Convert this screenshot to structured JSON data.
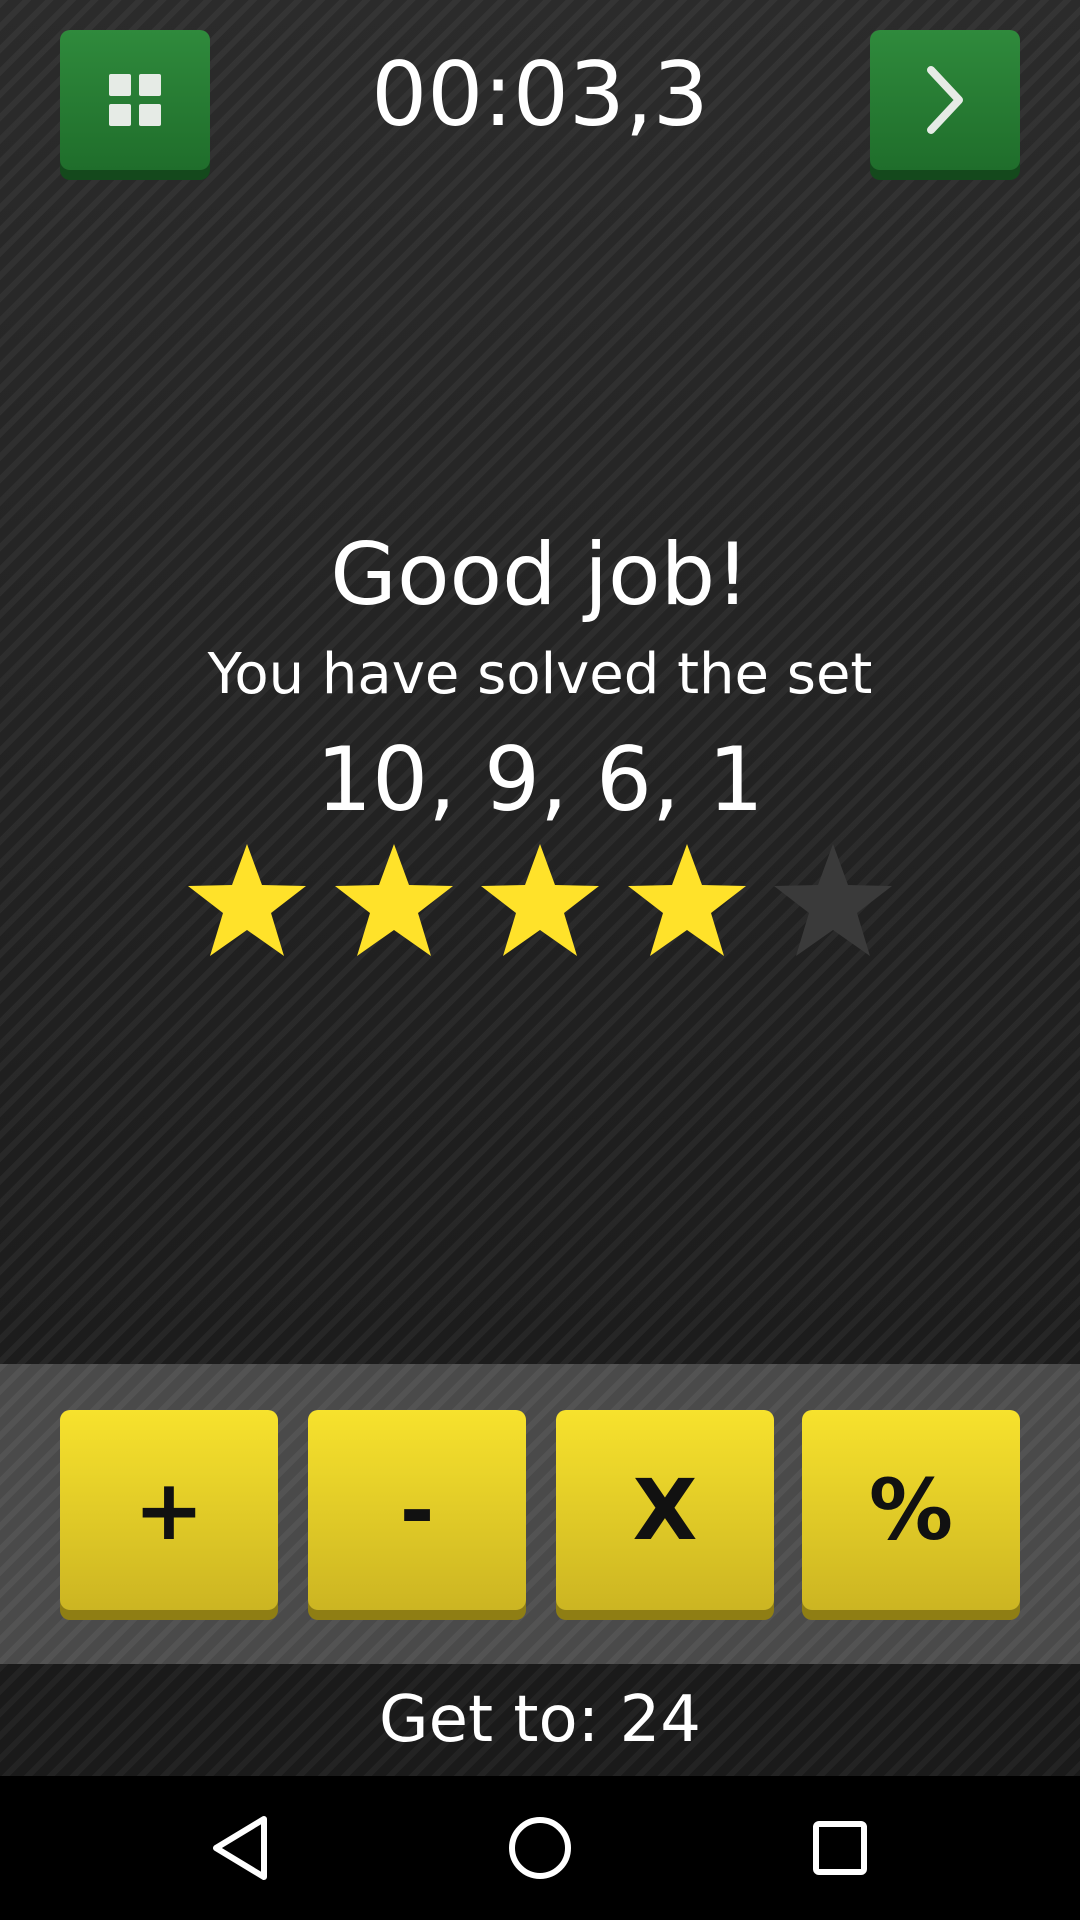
{
  "header": {
    "timer": "00:03,3",
    "menu_icon": "grid-icon",
    "next_icon": "chevron-right-icon"
  },
  "result": {
    "title": "Good job!",
    "message": "You have solved the set",
    "number_set": "10, 9, 6, 1",
    "rating": {
      "earned": 4,
      "total": 5
    }
  },
  "operators": [
    "+",
    "-",
    "X",
    "%"
  ],
  "target": {
    "text": "Get to: 24"
  },
  "colors": {
    "green_button": "#2f8a3c",
    "yellow_button": "#f7e22d",
    "star_filled": "#ffe22a",
    "star_empty": "#3a3a3a"
  },
  "nav": {
    "back_icon": "back-triangle-icon",
    "home_icon": "home-circle-icon",
    "recent_icon": "recent-apps-square-icon"
  }
}
